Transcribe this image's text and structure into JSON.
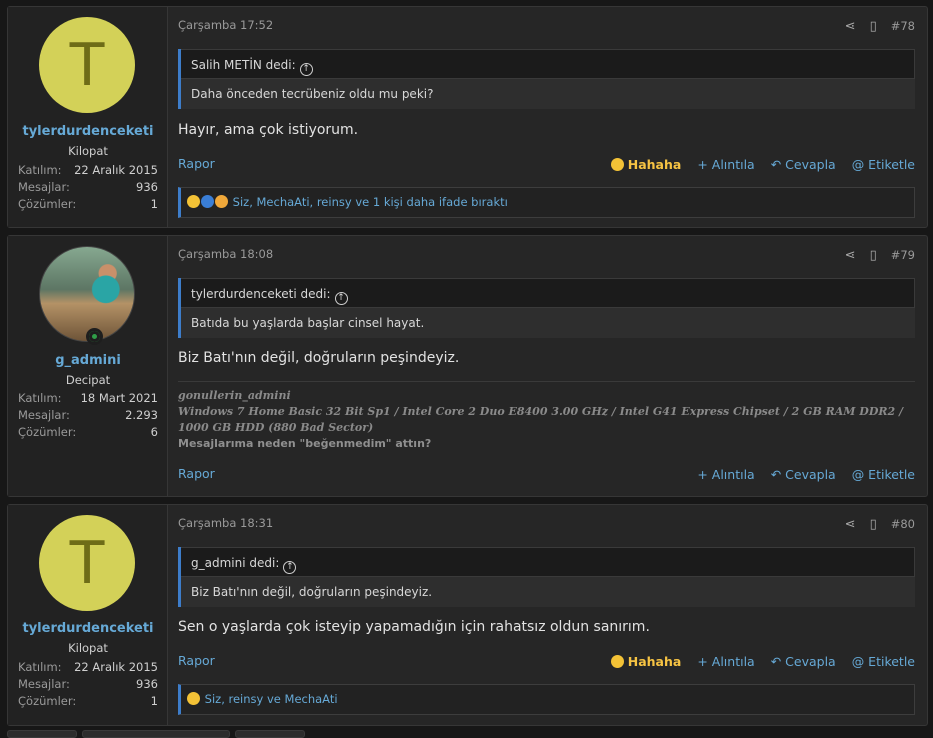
{
  "posts": [
    {
      "user": {
        "avatar_letter": "T",
        "name": "tylerdurdenceketi",
        "title": "Kilopat",
        "stats": [
          {
            "k": "Katılım:",
            "v": "22 Aralık 2015"
          },
          {
            "k": "Mesajlar:",
            "v": "936"
          },
          {
            "k": "Çözümler:",
            "v": "1"
          }
        ]
      },
      "date": "Çarşamba 17:52",
      "number": "#78",
      "quote_author": "Salih METİN dedi:",
      "quote_text": "Daha önceden tecrübeniz oldu mu peki?",
      "message": "Hayır, ama çok istiyorum.",
      "report": "Rapor",
      "reaction": "Hahaha",
      "quote_btn": "+ Alıntıla",
      "reply_btn": "Cevapla",
      "tag_btn": "@ Etiketle",
      "reacts_text": "Siz, MechaAti, reinsy ve 1 kişi daha ifade bıraktı"
    },
    {
      "user": {
        "name": "g_admini",
        "title": "Decipat",
        "stats": [
          {
            "k": "Katılım:",
            "v": "18 Mart 2021"
          },
          {
            "k": "Mesajlar:",
            "v": "2.293"
          },
          {
            "k": "Çözümler:",
            "v": "6"
          }
        ]
      },
      "date": "Çarşamba 18:08",
      "number": "#79",
      "quote_author": "tylerdurdenceketi dedi:",
      "quote_text": "Batıda bu yaşlarda başlar cinsel hayat.",
      "message": "Biz Batı'nın değil, doğruların peşindeyiz.",
      "signature": {
        "name": "gonullerin_admini",
        "specs": "Windows 7 Home Basic 32 Bit Sp1 / Intel Core 2 Duo E8400 3.00 GHz / Intel G41 Express Chipset / 2 GB RAM DDR2 / 1000 GB HDD (880 Bad Sector)",
        "note": "Mesajlarıma neden \"beğenmedim\" attın?"
      },
      "report": "Rapor",
      "quote_btn": "+ Alıntıla",
      "reply_btn": "Cevapla",
      "tag_btn": "@ Etiketle"
    },
    {
      "user": {
        "avatar_letter": "T",
        "name": "tylerdurdenceketi",
        "title": "Kilopat",
        "stats": [
          {
            "k": "Katılım:",
            "v": "22 Aralık 2015"
          },
          {
            "k": "Mesajlar:",
            "v": "936"
          },
          {
            "k": "Çözümler:",
            "v": "1"
          }
        ]
      },
      "date": "Çarşamba 18:31",
      "number": "#80",
      "quote_author": "g_admini dedi:",
      "quote_text": "Biz Batı'nın değil, doğruların peşindeyiz.",
      "message": "Sen o yaşlarda çok isteyip yapamadığın için rahatsız oldun sanırım.",
      "report": "Rapor",
      "reaction": "Hahaha",
      "quote_btn": "+ Alıntıla",
      "reply_btn": "Cevapla",
      "tag_btn": "@ Etiketle",
      "reacts_text": "Siz, reinsy ve MechaAti"
    }
  ],
  "icons": {
    "share": "share-icon",
    "bookmark": "bookmark-icon",
    "reply": "reply-icon",
    "laugh": "laughing-emoji-icon"
  },
  "colors": {
    "accent": "#66a9d6",
    "haha": "#f6c343",
    "quote_border": "#3d7dca",
    "avatar_bg": "#d3d158"
  }
}
